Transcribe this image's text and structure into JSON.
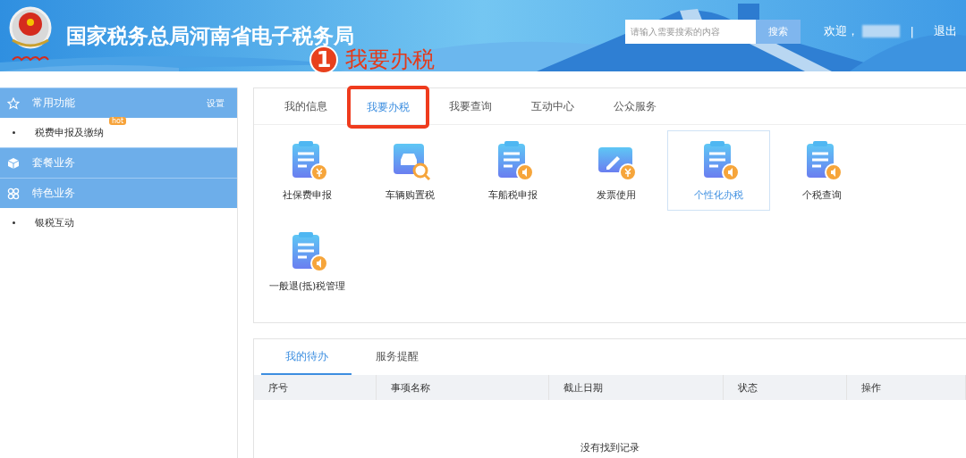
{
  "header": {
    "title": "国家税务总局河南省电子税务局",
    "search": {
      "placeholder": "请输入需要搜索的内容",
      "button": "搜索"
    },
    "welcome": "欢迎，",
    "separator": "|",
    "logout": "退出"
  },
  "annotation": {
    "number": "1",
    "label": "我要办税"
  },
  "sidebar": {
    "items": [
      {
        "kind": "header",
        "label": "常用功能",
        "action": "设置"
      },
      {
        "kind": "link",
        "label": "税费申报及缴纳",
        "badge": "hot"
      },
      {
        "kind": "header",
        "label": "套餐业务"
      },
      {
        "kind": "header",
        "label": "特色业务"
      },
      {
        "kind": "link",
        "label": "银税互动"
      }
    ]
  },
  "main_tabs": [
    {
      "label": "我的信息",
      "selected": false,
      "highlighted": false
    },
    {
      "label": "我要办税",
      "selected": true,
      "highlighted": true
    },
    {
      "label": "我要查询",
      "selected": false,
      "highlighted": false
    },
    {
      "label": "互动中心",
      "selected": false,
      "highlighted": false
    },
    {
      "label": "公众服务",
      "selected": false,
      "highlighted": false
    }
  ],
  "services": [
    {
      "kind": "doc-yen",
      "label": "社保费申报",
      "selected": false
    },
    {
      "kind": "car-search",
      "label": "车辆购置税",
      "selected": false
    },
    {
      "kind": "doc-sound",
      "label": "车船税申报",
      "selected": false
    },
    {
      "kind": "ticket-yen",
      "label": "发票使用",
      "selected": false
    },
    {
      "kind": "doc-sound",
      "label": "个性化办税",
      "selected": true
    },
    {
      "kind": "doc-sound",
      "label": "个税查询",
      "selected": false
    },
    {
      "kind": "doc-sound",
      "label": "一般退(抵)税管理",
      "selected": false
    }
  ],
  "todo_tabs": [
    {
      "label": "我的待办",
      "selected": true
    },
    {
      "label": "服务提醒",
      "selected": false
    }
  ],
  "table": {
    "columns": [
      "序号",
      "事项名称",
      "截止日期",
      "状态",
      "操作"
    ],
    "empty": "没有找到记录"
  }
}
